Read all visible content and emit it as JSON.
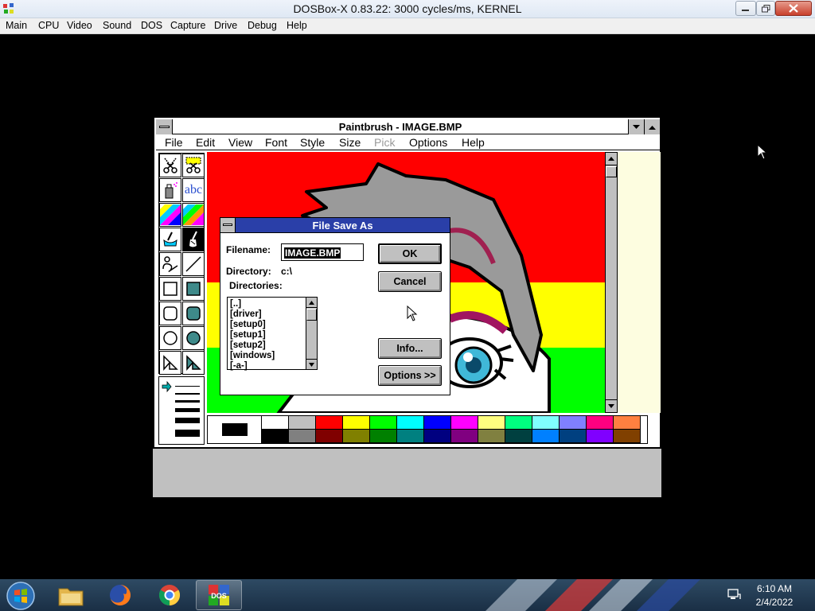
{
  "host": {
    "title": "DOSBox-X 0.83.22: 3000 cycles/ms, KERNEL",
    "menu": [
      "Main",
      "CPU",
      "Video",
      "Sound",
      "DOS",
      "Capture",
      "Drive",
      "Debug",
      "Help"
    ]
  },
  "paintbrush": {
    "title": "Paintbrush - IMAGE.BMP",
    "menu": [
      {
        "label": "File",
        "enabled": true
      },
      {
        "label": "Edit",
        "enabled": true
      },
      {
        "label": "View",
        "enabled": true
      },
      {
        "label": "Font",
        "enabled": true
      },
      {
        "label": "Style",
        "enabled": true
      },
      {
        "label": "Size",
        "enabled": true
      },
      {
        "label": "Pick",
        "enabled": false
      },
      {
        "label": "Options",
        "enabled": true
      },
      {
        "label": "Help",
        "enabled": true
      }
    ],
    "text_tool_label": "abc",
    "palette_top": [
      "#ffffff",
      "#c0c0c0",
      "#ff0000",
      "#ffff00",
      "#00ff00",
      "#00ffff",
      "#0000ff",
      "#ff00ff",
      "#ffff80",
      "#00ff80",
      "#80ffff",
      "#8080ff",
      "#ff0080",
      "#ff8040"
    ],
    "palette_bottom": [
      "#000000",
      "#808080",
      "#800000",
      "#808000",
      "#008000",
      "#008080",
      "#000080",
      "#800080",
      "#808040",
      "#004040",
      "#0080ff",
      "#004080",
      "#8000ff",
      "#804000"
    ],
    "current_color": "#000000"
  },
  "dialog": {
    "title": "File Save As",
    "filename_label": "Filename:",
    "filename_value": "IMAGE.BMP",
    "directory_label": "Directory:",
    "directory_value": "c:\\",
    "directories_label": "Directories:",
    "directories": [
      "[..]",
      "[driver]",
      "[setup0]",
      "[setup1]",
      "[setup2]",
      "[windows]",
      "[-a-]"
    ],
    "ok_label": "OK",
    "cancel_label": "Cancel",
    "info_label": "Info...",
    "options_label": "Options >>"
  },
  "taskbar": {
    "time": "6:10 AM",
    "date": "2/4/2022",
    "apps": [
      "windows-explorer",
      "firefox",
      "chrome",
      "dosbox-x"
    ]
  }
}
